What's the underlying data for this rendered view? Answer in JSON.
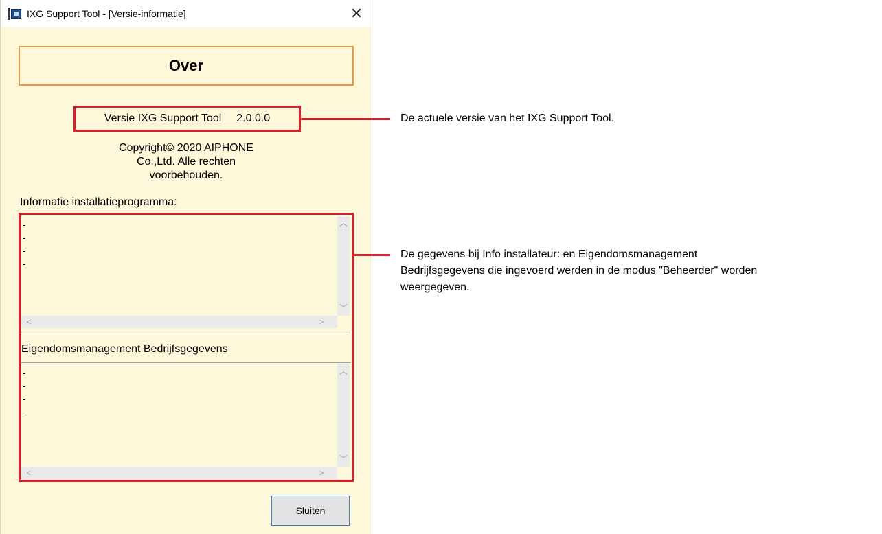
{
  "window": {
    "title": "IXG Support Tool - [Versie-informatie]",
    "close_glyph": "✕"
  },
  "header": {
    "title": "Over"
  },
  "version": {
    "label": "Versie IXG Support Tool",
    "number": "2.0.0.0"
  },
  "copyright": {
    "line1": "Copyright© 2020 AIPHONE",
    "line2": "Co.,Ltd. Alle rechten",
    "line3": "voorbehouden."
  },
  "installer": {
    "label": "Informatie installatieprogramma:",
    "lines": [
      "-",
      "-",
      "-",
      "-"
    ]
  },
  "owner": {
    "label": "Eigendomsmanagement Bedrijfsgegevens",
    "lines": [
      "-",
      "-",
      "-",
      "-"
    ]
  },
  "buttons": {
    "close": "Sluiten"
  },
  "annotations": {
    "version_note": "De actuele versie van het IXG Support Tool.",
    "data_note_line1": "De gegevens bij Info installateur: en Eigendomsmanagement",
    "data_note_line2": "Bedrijfsgegevens die ingevoerd werden in de modus \"Beheerder\" worden",
    "data_note_line3": "weergegeven."
  },
  "colors": {
    "annotation_red": "#d6202c",
    "header_border": "#f0983a",
    "dialog_bg": "#fdf8d9"
  }
}
